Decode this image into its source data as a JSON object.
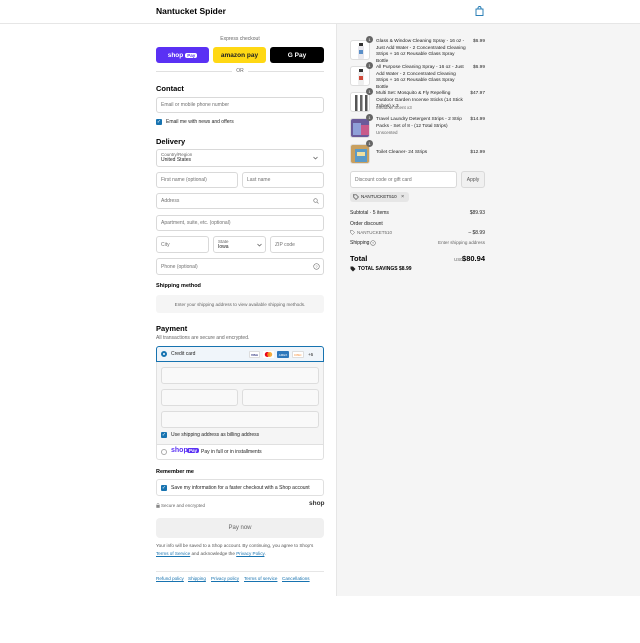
{
  "header": {
    "store_name": "Nantucket Spider"
  },
  "express": {
    "label": "Express checkout",
    "shop_pay": "shop",
    "shop_pay_badge": "Pay",
    "amazon_pay": "amazon pay",
    "google_pay": "G Pay",
    "or": "OR"
  },
  "contact": {
    "title": "Contact",
    "email_placeholder": "Email or mobile phone number",
    "news_label": "Email me with news and offers"
  },
  "delivery": {
    "title": "Delivery",
    "country_label": "Country/Region",
    "country_value": "United States",
    "first_name": "First name (optional)",
    "last_name": "Last name",
    "address": "Address",
    "apartment": "Apartment, suite, etc. (optional)",
    "city": "City",
    "state_label": "State",
    "state_value": "Iowa",
    "zip": "ZIP code",
    "phone": "Phone (optional)"
  },
  "shipping_method": {
    "title": "Shipping method",
    "message": "Enter your shipping address to view available shipping methods."
  },
  "payment": {
    "title": "Payment",
    "subtitle": "All transactions are secure and encrypted.",
    "credit_card": "Credit card",
    "more_cards": "+6",
    "billing_same": "Use shipping address as billing address",
    "shop_pay_label": "shop",
    "shop_pay_badge": "Pay",
    "shop_pay_text": "Pay in full or in installments"
  },
  "remember": {
    "title": "Remember me",
    "save_label": "Save my information for a faster checkout with a Shop account",
    "secure": "Secure and encrypted",
    "shop_logo": "shop"
  },
  "pay_button": "Pay now",
  "legal": {
    "line1": "Your info will be saved to a Shop account. By continuing, you agree to Shop's",
    "terms": "Terms of Service",
    "and": "and acknowledge the",
    "privacy": "Privacy Policy",
    "end": "."
  },
  "footer_links": [
    "Refund policy",
    "Shipping",
    "Privacy policy",
    "Terms of service",
    "Cancellations"
  ],
  "order": {
    "items": [
      {
        "qty": "1",
        "title": "Glass & Window Cleaning Spray - 16 oz - Just Add Water - 2 Concentrated Cleaning Strips + 16 oz Reusable Glass Spray Bottle",
        "variant": "",
        "price": "$6.99"
      },
      {
        "qty": "1",
        "title": "All Purpose Cleaning Spray - 16 oz - Just Add Water - 2 Concentrated Cleaning Strips + 16 oz Reusable Glass Spray Bottle",
        "variant": "",
        "price": "$6.99"
      },
      {
        "qty": "1",
        "title": "Multi Set: Mosquito & Fly Repelling Outdoor Garden Incense Sticks (14 Stick Tubes) x 3",
        "variant": "Meadow Scent x3",
        "price": "$47.97"
      },
      {
        "qty": "1",
        "title": "Travel Laundry Detergent Strips - 2 Strip Packs - Set of 8 - (12 Total Strips)",
        "variant": "Unscented",
        "price": "$14.99"
      },
      {
        "qty": "1",
        "title": "Toilet Cleaner- 24 Strips",
        "variant": "",
        "price": "$12.99"
      }
    ],
    "discount_placeholder": "Discount code or gift card",
    "apply": "Apply",
    "applied_code": "NANTUCKET510",
    "subtotal_label": "Subtotal · 5 items",
    "subtotal_value": "$89.93",
    "order_discount_label": "Order discount",
    "order_discount_code": "NANTUCKET510",
    "order_discount_value": "– $8.99",
    "shipping_label": "Shipping",
    "shipping_value": "Enter shipping address",
    "total_label": "Total",
    "currency": "USD",
    "total_value": "$80.94",
    "savings_label": "TOTAL SAVINGS",
    "savings_value": "$8.99"
  },
  "colors": {
    "accent": "#1773b0",
    "shop_pay": "#5a31f4",
    "amazon": "#ffd814"
  },
  "icons": {
    "bag": "bag-icon",
    "search": "search-icon",
    "help": "question-icon",
    "tag": "tag-icon"
  }
}
